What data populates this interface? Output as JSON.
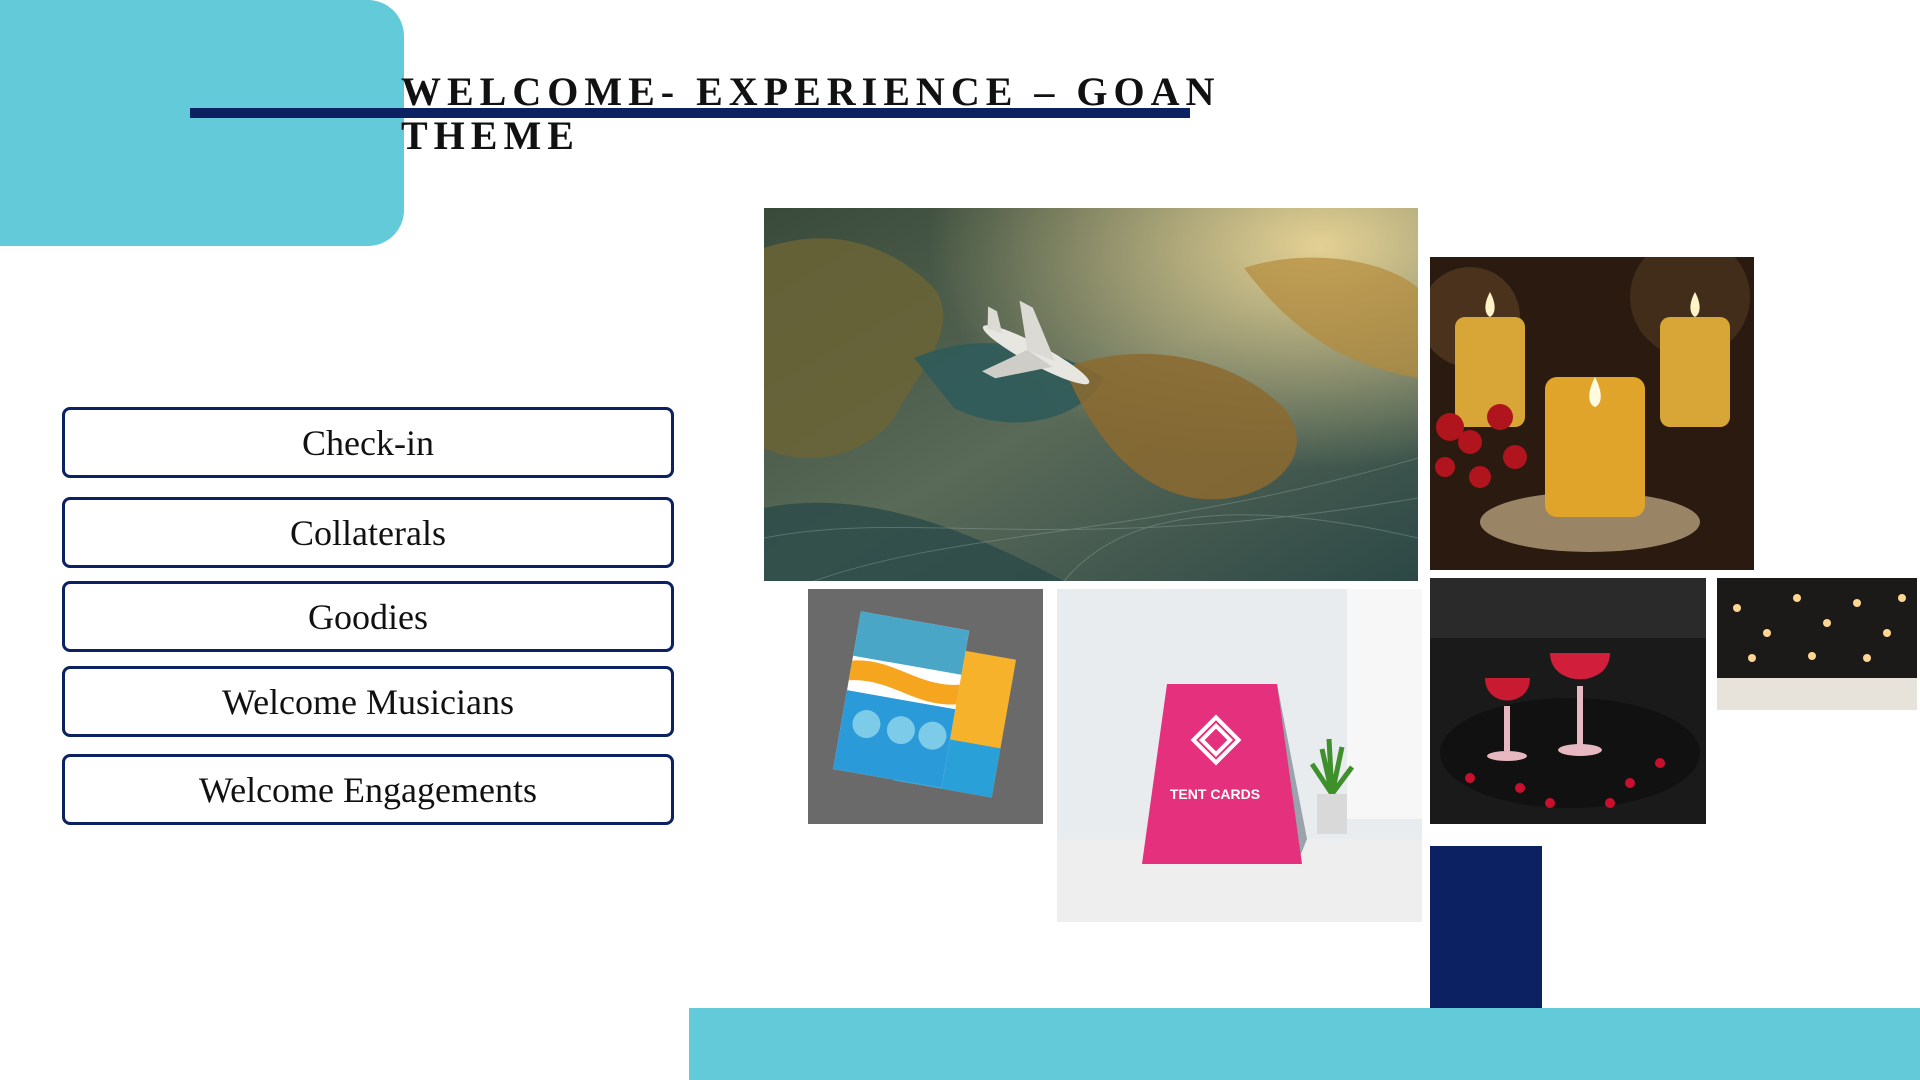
{
  "slide": {
    "title_line1": "WELCOME- EXPERIENCE – GOAN",
    "title_line2": "THEME"
  },
  "menu": {
    "items": [
      {
        "label": "Check-in"
      },
      {
        "label": "Collaterals"
      },
      {
        "label": "Goodies"
      },
      {
        "label": "Welcome Musicians"
      },
      {
        "label": "Welcome Engagements"
      }
    ]
  },
  "images": {
    "tent_card_text": "TENT CARDS"
  },
  "colors": {
    "teal": "#62cad9",
    "navy": "#0b2162"
  }
}
